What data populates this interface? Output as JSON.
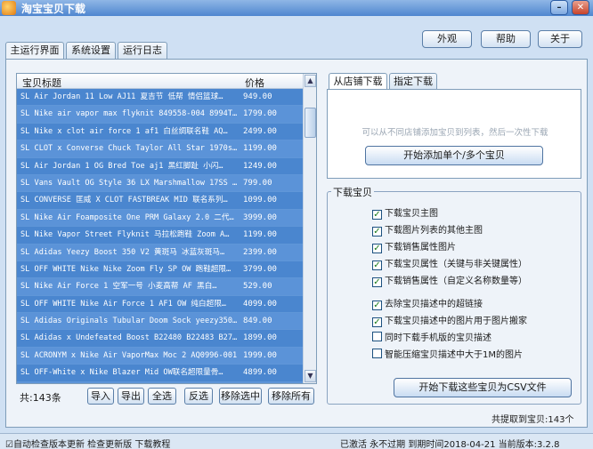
{
  "window": {
    "title": "淘宝宝贝下载"
  },
  "top_buttons": [
    "外观",
    "帮助",
    "关于"
  ],
  "tabs": [
    "主运行界面",
    "系统设置",
    "运行日志"
  ],
  "list": {
    "columns": [
      "宝贝标题",
      "价格"
    ],
    "rows": [
      {
        "name": "SL Air Jordan 11 Low AJ11 夏吉节 低帮 情侣篮球…",
        "price": "949.00"
      },
      {
        "name": "SL Nike air vapor max flyknit 849558-004 8994T…",
        "price": "1799.00"
      },
      {
        "name": "SL Nike x clot air force 1 af1 白丝绸联名鞋 AQ…",
        "price": "2499.00"
      },
      {
        "name": "SL CLOT x Converse Chuck Taylor All Star 1970s…",
        "price": "1199.00"
      },
      {
        "name": "SL Air Jordan 1 OG Bred Toe aj1 黑红脚趾 小闪…",
        "price": "1249.00"
      },
      {
        "name": "SL Vans Vault OG Style 36 LX Marshmallow 17SS …",
        "price": "799.00"
      },
      {
        "name": "SL CONVERSE 匡威 X CLOT FASTBREAK MID 联名系列…",
        "price": "1099.00"
      },
      {
        "name": "SL Nike Air Foamposite One PRM Galaxy 2.0 二代…",
        "price": "3999.00"
      },
      {
        "name": "SL Nike Vapor Street Flyknit 马拉松跑鞋 Zoom A…",
        "price": "1199.00"
      },
      {
        "name": "SL Adidas Yeezy Boost 350 V2 黄斑马 冰蓝灰斑马…",
        "price": "2399.00"
      },
      {
        "name": "SL OFF WHITE Nike Nike Zoom Fly SP OW 跑鞋超限…",
        "price": "3799.00"
      },
      {
        "name": "SL  Nike Air Force 1 空军一号 小麦高帮 AF 黑白…",
        "price": "529.00"
      },
      {
        "name": "SL OFF WHITE Nike Air Force 1 AF1 OW 纯白超限…",
        "price": "4099.00"
      },
      {
        "name": "SL Adidas Originals Tubular Doom Sock yeezy350…",
        "price": "849.00"
      },
      {
        "name": "SL Adidas x Undefeated Boost B22480 B22483 B27…",
        "price": "1899.00"
      },
      {
        "name": "SL ACRONYM x Nike Air VaporMax Moc 2 AQ0996-001",
        "price": "1999.00"
      },
      {
        "name": "SL OFF-White x Nike Blazer Mid OW联名超限量骨…",
        "price": "4899.00"
      },
      {
        "name": "SL …",
        "price": ""
      }
    ]
  },
  "list_count": "共:143条",
  "list_buttons": [
    "导入",
    "导出",
    "全选",
    "反选",
    "移除选中",
    "移除所有"
  ],
  "right_tabs": [
    "从店铺下载",
    "指定下载"
  ],
  "right_hint": "可以从不同店铺添加宝贝到列表，然后一次性下载",
  "add_button": "开始添加单个/多个宝贝",
  "download_group": {
    "title": "下载宝贝",
    "options": [
      {
        "label": "下载宝贝主图",
        "checked": true
      },
      {
        "label": "下载图片列表的其他主图",
        "checked": true
      },
      {
        "label": "下载销售属性图片",
        "checked": true
      },
      {
        "label": "下载宝贝属性（关键与非关键属性）",
        "checked": true
      },
      {
        "label": "下载销售属性（自定义名称数量等）",
        "checked": true
      },
      {
        "label": "去除宝贝描述中的超链接",
        "checked": true
      },
      {
        "label": "下载宝贝描述中的图片用于图片搬家",
        "checked": true
      },
      {
        "label": "同时下载手机版的宝贝描述",
        "checked": false
      },
      {
        "label": "智能压缩宝贝描述中大于1M的图片",
        "checked": false
      }
    ],
    "export_button": "开始下载这些宝贝为CSV文件"
  },
  "summary": "共提取到宝贝:143个",
  "status": {
    "left": "☑自动检查版本更新    检查更新版    下载教程",
    "right": "已激活  永不过期  到期时间2018-04-21    当前版本:3.2.8"
  }
}
